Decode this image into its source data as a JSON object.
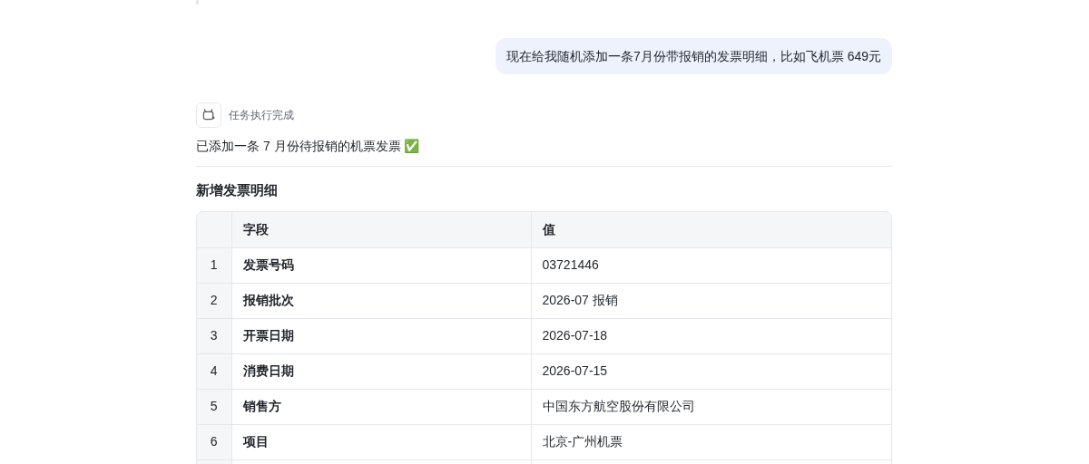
{
  "user_message": "现在给我随机添加一条7月份带报销的发票明细，比如飞机票 649元",
  "task_status": "任务执行完成",
  "reply": "已添加一条 7 月份待报销的机票发票 ✅",
  "section_title": "新增发票明细",
  "table": {
    "columns": [
      "字段",
      "值"
    ],
    "rows": [
      {
        "index": "1",
        "field": "发票号码",
        "value": "03721446"
      },
      {
        "index": "2",
        "field": "报销批次",
        "value": "2026-07 报销"
      },
      {
        "index": "3",
        "field": "开票日期",
        "value": "2026-07-18"
      },
      {
        "index": "4",
        "field": "消费日期",
        "value": "2026-07-15"
      },
      {
        "index": "5",
        "field": "销售方",
        "value": "中国东方航空股份有限公司"
      },
      {
        "index": "6",
        "field": "项目",
        "value": "北京-广州机票"
      }
    ]
  }
}
